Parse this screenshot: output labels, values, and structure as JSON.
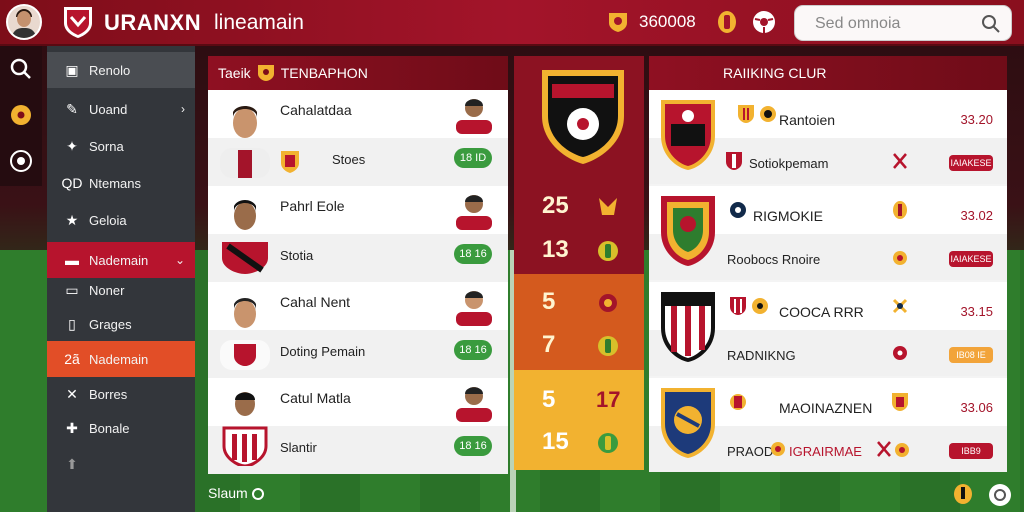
{
  "header": {
    "brand": "URANXN",
    "subtitle": "lineamain",
    "coins": "360008",
    "search_placeholder": "Sed omnoia"
  },
  "sidebar": {
    "items": [
      {
        "label": "Renolo",
        "icon": "card-icon"
      },
      {
        "label": "Uoand",
        "icon": "pencil-icon"
      },
      {
        "label": "Sorna",
        "icon": "tag-icon"
      },
      {
        "label": "Ntemans",
        "icon": "qd-icon",
        "icon_text": "QD"
      },
      {
        "label": "Geloia",
        "icon": "star-icon"
      },
      {
        "label": "Nademain",
        "icon": "window-icon"
      },
      {
        "label": "Noner",
        "icon": "monitor-icon"
      },
      {
        "label": "Grages",
        "icon": "phone-icon"
      },
      {
        "label": "Nademain",
        "icon": "badge-icon",
        "icon_text": "2ã"
      },
      {
        "label": "Borres",
        "icon": "cross-icon"
      },
      {
        "label": "Bonale",
        "icon": "puzzle-icon"
      }
    ]
  },
  "team_panel": {
    "title": "Taeik",
    "title2": "TENBAPHON",
    "players": [
      {
        "name": "Cahalatdaa",
        "sub": "Stoes",
        "value": "18 ID"
      },
      {
        "name": "Pahrl Eole",
        "sub": "Stotia",
        "value": "18 16"
      },
      {
        "name": "Cahal Nent",
        "sub": "Doting Pemain",
        "value": "18 16"
      },
      {
        "name": "Catul Matla",
        "sub": "Slantir",
        "value": "18 16"
      }
    ]
  },
  "stats_panel": {
    "values": [
      "25",
      "13",
      "5",
      "7",
      "5",
      "15"
    ],
    "extras": [
      "17"
    ]
  },
  "ranking_panel": {
    "title": "RAIIKING CLUR",
    "clubs": [
      {
        "name": "Rantoien",
        "sub": "Sotiokpemam",
        "value": "33.20",
        "badge": "IAIAKESE"
      },
      {
        "name": "RIGMOKIE",
        "sub": "Roobocs Rnoire",
        "value": "33.02",
        "badge": "IAIAKESE"
      },
      {
        "name": "COOCA RRR",
        "sub": "RADNIKNG",
        "value": "33.15",
        "badge": "IB08 IE"
      },
      {
        "name": "MAOINAZNEN",
        "sub": "PRAOD",
        "sub2": "IGRAIRMAE",
        "value": "33.06",
        "badge": "IBB9"
      }
    ]
  },
  "footer": {
    "text": "Slaum"
  },
  "colors": {
    "primary_red": "#a3142a",
    "accent_orange": "#e24e27",
    "pill_green": "#3a9b3e",
    "sidebar_bg": "#33363b"
  }
}
